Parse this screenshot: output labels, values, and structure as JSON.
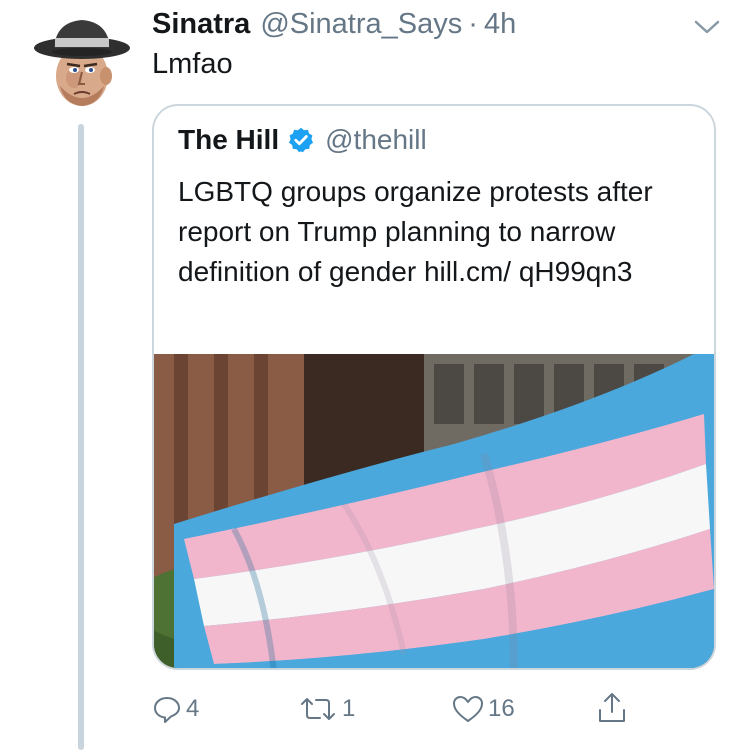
{
  "tweet": {
    "author": {
      "display_name": "Sinatra",
      "handle": "@Sinatra_Says",
      "avatar_icon": "cartoon-man-fedora-avatar"
    },
    "separator": "·",
    "time": "4h",
    "text": "Lmfao",
    "menu_icon": "chevron-down-icon"
  },
  "quoted_tweet": {
    "display_name": "The Hill",
    "verified_icon": "verified-badge-icon",
    "handle": "@thehill",
    "text": "LGBTQ groups organize protests after report on Trump planning to narrow definition of gender hill.cm/ qH99qn3",
    "media_description_icon": "transgender-pride-flag-photo"
  },
  "actions": {
    "reply_count": "4",
    "retweet_count": "1",
    "like_count": "16"
  },
  "colors": {
    "secondary_text": "#657786",
    "verified_blue": "#1da1f2",
    "border": "#ccd6dd",
    "flag_blue": "#4aa8dd",
    "flag_pink": "#f2b6cc"
  }
}
